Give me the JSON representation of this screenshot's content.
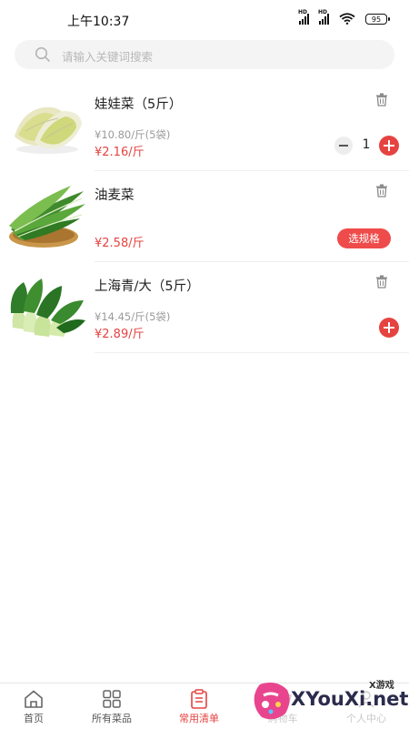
{
  "status_bar": {
    "time": "上午10:37",
    "battery": "95"
  },
  "search": {
    "placeholder": "请输入关键词搜索"
  },
  "products": [
    {
      "name": "娃娃菜（5斤）",
      "sub_price": "¥10.80/斤(5袋)",
      "price": "¥2.16/斤",
      "quantity": "1",
      "action": "stepper"
    },
    {
      "name": "油麦菜",
      "price": "¥2.58/斤",
      "spec_label": "选规格",
      "action": "spec"
    },
    {
      "name": "上海青/大（5斤）",
      "sub_price": "¥14.45/斤(5袋)",
      "price": "¥2.89/斤",
      "action": "add"
    }
  ],
  "tabbar": {
    "tabs": [
      {
        "label": "首页",
        "icon": "home-icon"
      },
      {
        "label": "所有菜品",
        "icon": "grid-icon"
      },
      {
        "label": "常用清单",
        "icon": "list-icon",
        "active": true
      },
      {
        "label": "购物车",
        "icon": "cart-icon"
      },
      {
        "label": "个人中心",
        "icon": "user-icon"
      }
    ],
    "active_color": "#e64340"
  },
  "watermark": {
    "brand": "XYouXi.net",
    "tagline": "X游戏"
  },
  "colors": {
    "accent": "#e64340",
    "muted": "#9a9a9a"
  }
}
